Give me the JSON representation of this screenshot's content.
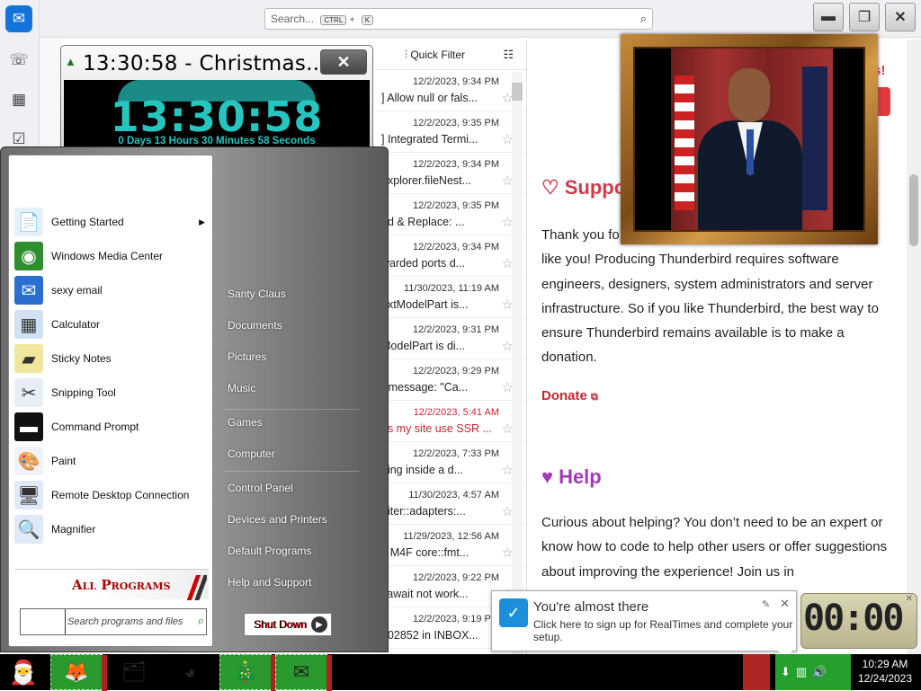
{
  "thunderbird": {
    "search_placeholder": "Search...",
    "search_shortcut_ctrl": "CTRL",
    "search_shortcut_plus": "+",
    "search_shortcut_k": "K",
    "quick_filter": "Quick Filter",
    "messages": [
      {
        "date": "12/2/2023, 9:34 PM",
        "subject": "] Allow null or fals..."
      },
      {
        "date": "12/2/2023, 9:35 PM",
        "subject": "] Integrated Termi..."
      },
      {
        "date": "12/2/2023, 9:34 PM",
        "subject": "explorer.fileNest..."
      },
      {
        "date": "12/2/2023, 9:35 PM",
        "subject": "nd & Replace: ..."
      },
      {
        "date": "12/2/2023, 9:34 PM",
        "subject": "warded ports d..."
      },
      {
        "date": "11/30/2023, 11:19 AM",
        "subject": "extModelPart is..."
      },
      {
        "date": "12/2/2023, 9:31 PM",
        "subject": "ModelPart is di..."
      },
      {
        "date": "12/2/2023, 9:29 PM",
        "subject": "r message: \"Ca..."
      },
      {
        "date": "12/2/2023, 5:41 AM",
        "subject": "es my site use SSR ..."
      },
      {
        "date": "12/2/2023, 7:33 PM",
        "subject": "ning inside a d..."
      },
      {
        "date": "11/30/2023, 4:57 AM",
        "subject": "::iter::adapters:..."
      },
      {
        "date": "11/29/2023, 12:56 AM",
        "subject": "x M4F core::fmt..."
      },
      {
        "date": "12/2/2023, 9:22 PM",
        "subject": "l await not work..."
      },
      {
        "date": "12/2/2023, 9:19 PM",
        "subject": "102852 in INBOX..."
      }
    ],
    "content": {
      "partial_top": "us!",
      "support_heading": "Suppo",
      "support_para": "Thank you fo                                                   d by users like you! Producing Thunderbird requires software engineers, designers, system administrators and server infrastructure. So if you like Thunderbird, the best way to ensure Thunderbird remains available is to make a donation.",
      "donate": "Donate",
      "help_heading": "Help",
      "help_para": "Curious about helping? You don’t need to be an expert or know how to code to help other users or offer suggestions about improving the experience! Join us in"
    }
  },
  "countdown": {
    "title": "13:30:58 - Christmas...",
    "time": "13:30:58",
    "detail": "0 Days 13 Hours 30 Minutes 58 Seconds"
  },
  "start_menu": {
    "left_items": [
      {
        "label": "Getting Started",
        "icon": "getting-started-icon",
        "glyph": "📄",
        "bg": "#e4f0fa"
      },
      {
        "label": "Windows Media Center",
        "icon": "media-center-icon",
        "glyph": "◉",
        "bg": "#2f8f2f"
      },
      {
        "label": "sexy email",
        "icon": "thunderbird-icon",
        "glyph": "✉",
        "bg": "#2a6fd0"
      },
      {
        "label": "Calculator",
        "icon": "calculator-icon",
        "glyph": "▦",
        "bg": "#cfe1f2"
      },
      {
        "label": "Sticky Notes",
        "icon": "sticky-notes-icon",
        "glyph": "▰",
        "bg": "#f1e79c"
      },
      {
        "label": "Snipping Tool",
        "icon": "scissors-icon",
        "glyph": "✂",
        "bg": "#e8eef6"
      },
      {
        "label": "Command Prompt",
        "icon": "cmd-icon",
        "glyph": "▬",
        "bg": "#111111"
      },
      {
        "label": "Paint",
        "icon": "paint-icon",
        "glyph": "🎨",
        "bg": "#eef3fb"
      },
      {
        "label": "Remote Desktop Connection",
        "icon": "remote-desktop-icon",
        "glyph": "🖥",
        "bg": "#dfe9f7"
      },
      {
        "label": "Magnifier",
        "icon": "magnifier-icon",
        "glyph": "🔍",
        "bg": "#dfe9f7"
      }
    ],
    "all_programs": "All Programs",
    "search_placeholder": "Search programs and files",
    "right_items": [
      "Santy Claus",
      "Documents",
      "Pictures",
      "Music",
      "Games",
      "Computer",
      "Control Panel",
      "Devices and Printers",
      "Default Programs",
      "Help and Support"
    ],
    "shutdown": "Shut Down"
  },
  "notification": {
    "title": "You're almost there",
    "body": "Click here to sign up for RealTimes and complete your setup."
  },
  "clock_widget": {
    "digits": "00:00"
  },
  "taskbar": {
    "time": "10:29 AM",
    "date": "12/24/2023"
  },
  "colors": {
    "accent_red": "#c42637",
    "help_purple": "#a23ab8",
    "countdown_cyan": "#26c6c0",
    "taskbar_green": "#2a9a2e"
  }
}
